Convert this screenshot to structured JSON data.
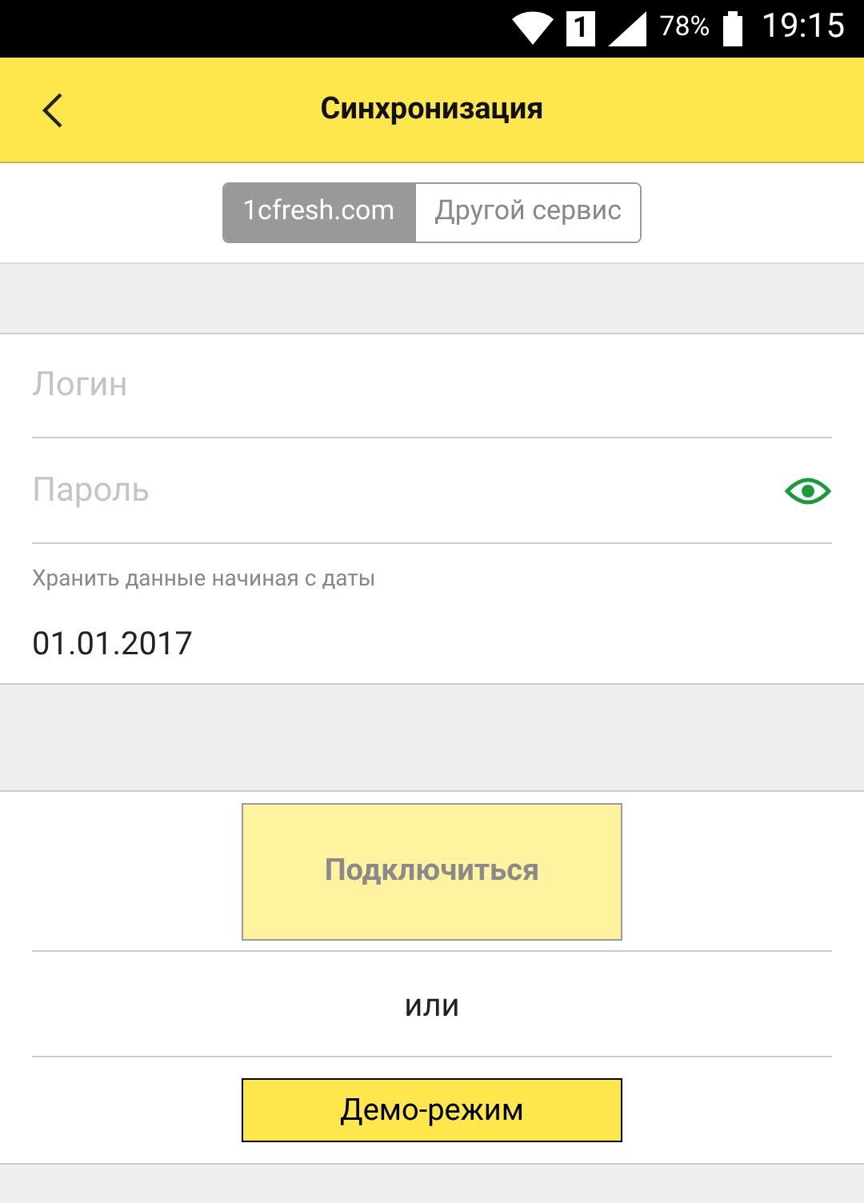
{
  "status_bar": {
    "sim": "1",
    "battery": "78%",
    "time": "19:15"
  },
  "header": {
    "title": "Синхронизация"
  },
  "segments": [
    {
      "label": "1cfresh.com",
      "selected": true
    },
    {
      "label": "Другой сервис",
      "selected": false
    }
  ],
  "form": {
    "login": {
      "placeholder": "Логин"
    },
    "password": {
      "placeholder": "Пароль"
    },
    "date": {
      "label": "Хранить данные начиная с даты",
      "value": "01.01.2017"
    }
  },
  "connect_button": {
    "label": "Подключиться",
    "disabled": true
  },
  "separator_text": "или",
  "demo_button": {
    "label": "Демо-режим",
    "disabled": false
  }
}
